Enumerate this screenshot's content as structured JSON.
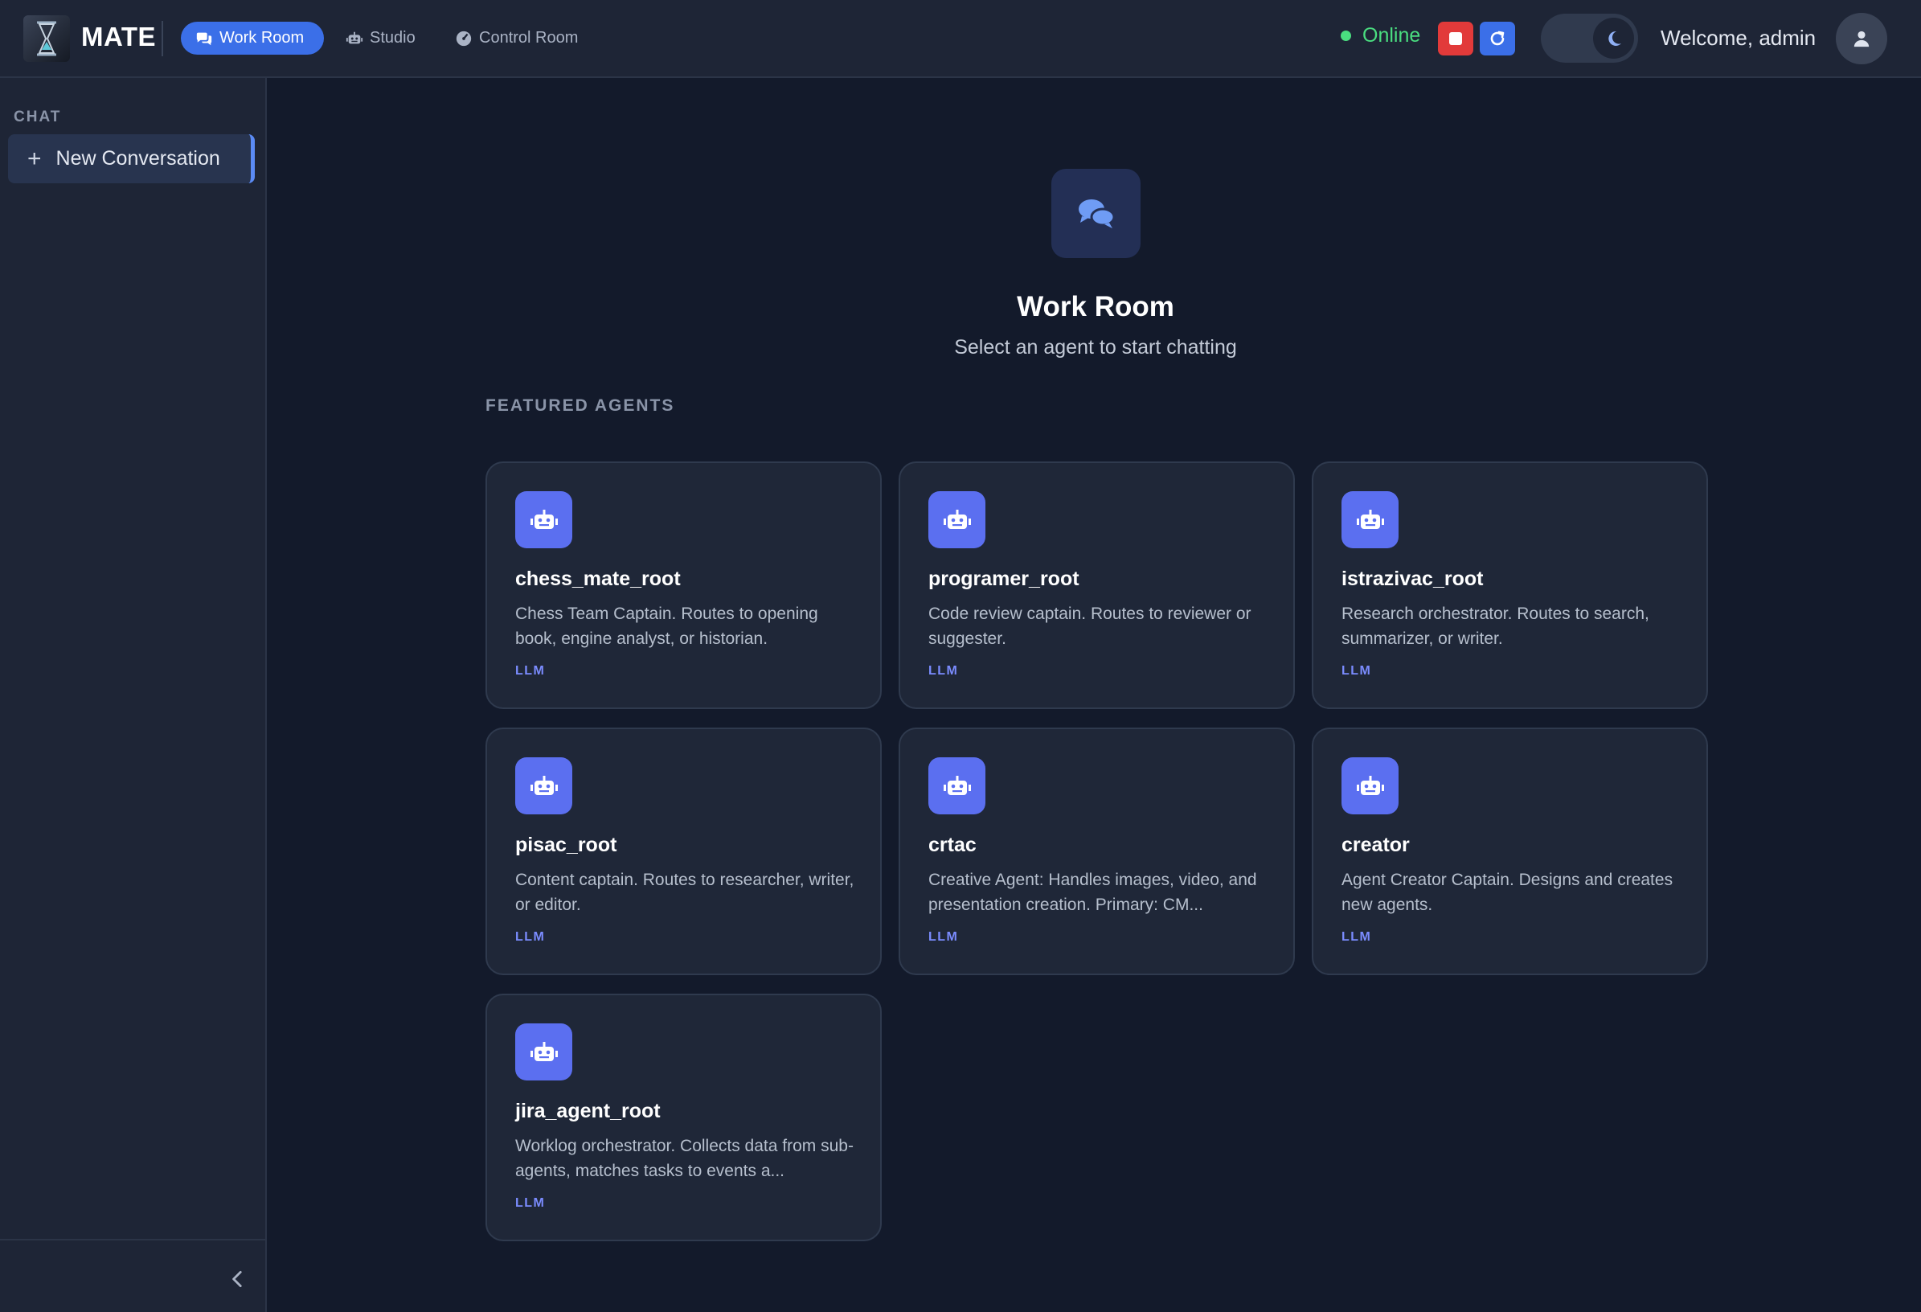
{
  "header": {
    "brand": "MATE",
    "tabs": [
      {
        "label": "Work Room",
        "icon": "chat-bubbles-icon",
        "active": true
      },
      {
        "label": "Studio",
        "icon": "robot-icon",
        "active": false
      },
      {
        "label": "Control Room",
        "icon": "gauge-icon",
        "active": false
      }
    ],
    "status": "Online",
    "welcome": "Welcome, admin"
  },
  "sidebar": {
    "heading": "CHAT",
    "new_conversation": "New Conversation"
  },
  "main": {
    "title": "Work Room",
    "subtitle": "Select an agent to start chatting",
    "section": "FEATURED AGENTS",
    "agents": [
      {
        "name": "chess_mate_root",
        "description": "Chess Team Captain. Routes to opening book, engine analyst, or historian.",
        "tag": "LLM"
      },
      {
        "name": "programer_root",
        "description": "Code review captain. Routes to reviewer or suggester.",
        "tag": "LLM"
      },
      {
        "name": "istrazivac_root",
        "description": "Research orchestrator. Routes to search, summarizer, or writer.",
        "tag": "LLM"
      },
      {
        "name": "pisac_root",
        "description": "Content captain. Routes to researcher, writer, or editor.",
        "tag": "LLM"
      },
      {
        "name": "crtac",
        "description": "Creative Agent: Handles images, video, and presentation creation. Primary: CM...",
        "tag": "LLM"
      },
      {
        "name": "creator",
        "description": "Agent Creator Captain. Designs and creates new agents.",
        "tag": "LLM"
      },
      {
        "name": "jira_agent_root",
        "description": "Worklog orchestrator. Collects data from sub-agents, matches tasks to events a...",
        "tag": "LLM"
      }
    ]
  },
  "colors": {
    "accent": "#3b6fe8",
    "online": "#4ade80",
    "stop": "#e23a3a",
    "agent_icon": "#5b6ff0",
    "tag": "#7b8cff"
  }
}
